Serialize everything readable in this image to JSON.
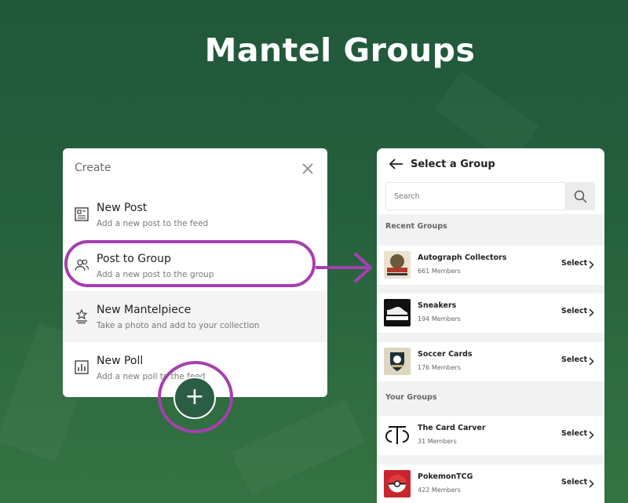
{
  "title": "Mantel Groups",
  "create_menu": {
    "header": "Create",
    "items": [
      {
        "title": "New Post",
        "subtitle": "Add a new post to the feed",
        "icon": "post-icon"
      },
      {
        "title": "Post to Group",
        "subtitle": "Add a new post to the group",
        "icon": "group-icon"
      },
      {
        "title": "New Mantelpiece",
        "subtitle": "Take a photo and add to your collection",
        "icon": "trophy-icon"
      },
      {
        "title": "New Poll",
        "subtitle": "Add a new poll to the feed",
        "icon": "poll-icon"
      }
    ],
    "fab_label": "+"
  },
  "select_group": {
    "title": "Select a Group",
    "search_placeholder": "Search",
    "recent_label": "Recent Groups",
    "your_label": "Your Groups",
    "select_label": "Select",
    "recent_groups": [
      {
        "name": "Autograph Collectors",
        "members": "661 Members"
      },
      {
        "name": "Sneakers",
        "members": "194 Members"
      },
      {
        "name": "Soccer Cards",
        "members": "176 Members"
      }
    ],
    "your_groups": [
      {
        "name": "The Card Carver",
        "members": "31 Members"
      },
      {
        "name": "PokemonTCG",
        "members": "422 Members"
      }
    ]
  },
  "colors": {
    "background": "#245f3d",
    "accent": "#a63fb0",
    "fab": "#2b5d45"
  }
}
